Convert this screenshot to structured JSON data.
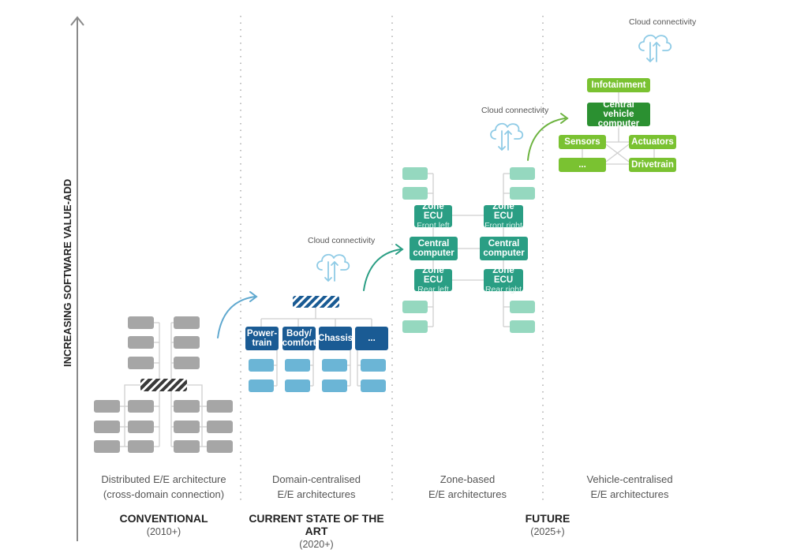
{
  "axis": {
    "label": "INCREASING SOFTWARE VALUE-ADD"
  },
  "colors": {
    "conventional": "#a6a6a6",
    "domain_dark": "#1a5b94",
    "domain_light": "#6bb5d6",
    "zone_dark": "#2a9e84",
    "zone_light": "#95d8bf",
    "vehicle_light": "#7ac231",
    "vehicle_dark": "#2b9031"
  },
  "columns": [
    {
      "id": "distributed",
      "caption_line1": "Distributed E/E architecture",
      "caption_line2": "(cross-domain connection)"
    },
    {
      "id": "domain",
      "caption_line1": "Domain-centralised",
      "caption_line2": "E/E architectures",
      "cloud_label": "Cloud connectivity",
      "domains": [
        "Power-\ntrain",
        "Body/\ncomfort",
        "Chassis",
        "..."
      ]
    },
    {
      "id": "zone",
      "caption_line1": "Zone-based",
      "caption_line2": "E/E architectures",
      "cloud_label": "Cloud connectivity",
      "zone_ecu": "Zone ECU",
      "zones": {
        "front_left": "Front left",
        "front_right": "Front right",
        "rear_left": "Rear left",
        "rear_right": "Rear right"
      },
      "central": "Central computer"
    },
    {
      "id": "vehicle",
      "caption_line1": "Vehicle-centralised",
      "caption_line2": "E/E architectures",
      "cloud_label": "Cloud connectivity",
      "infotainment": "Infotainment",
      "central": "Central vehicle computer",
      "sensors": "Sensors",
      "actuators": "Actuators",
      "other": "...",
      "drivetrain": "Drivetrain"
    }
  ],
  "eras": [
    {
      "title": "CONVENTIONAL",
      "years": "(2010+)"
    },
    {
      "title": "CURRENT STATE OF THE ART",
      "years": "(2020+)"
    },
    {
      "title": "FUTURE",
      "years": "(2025+)"
    }
  ]
}
